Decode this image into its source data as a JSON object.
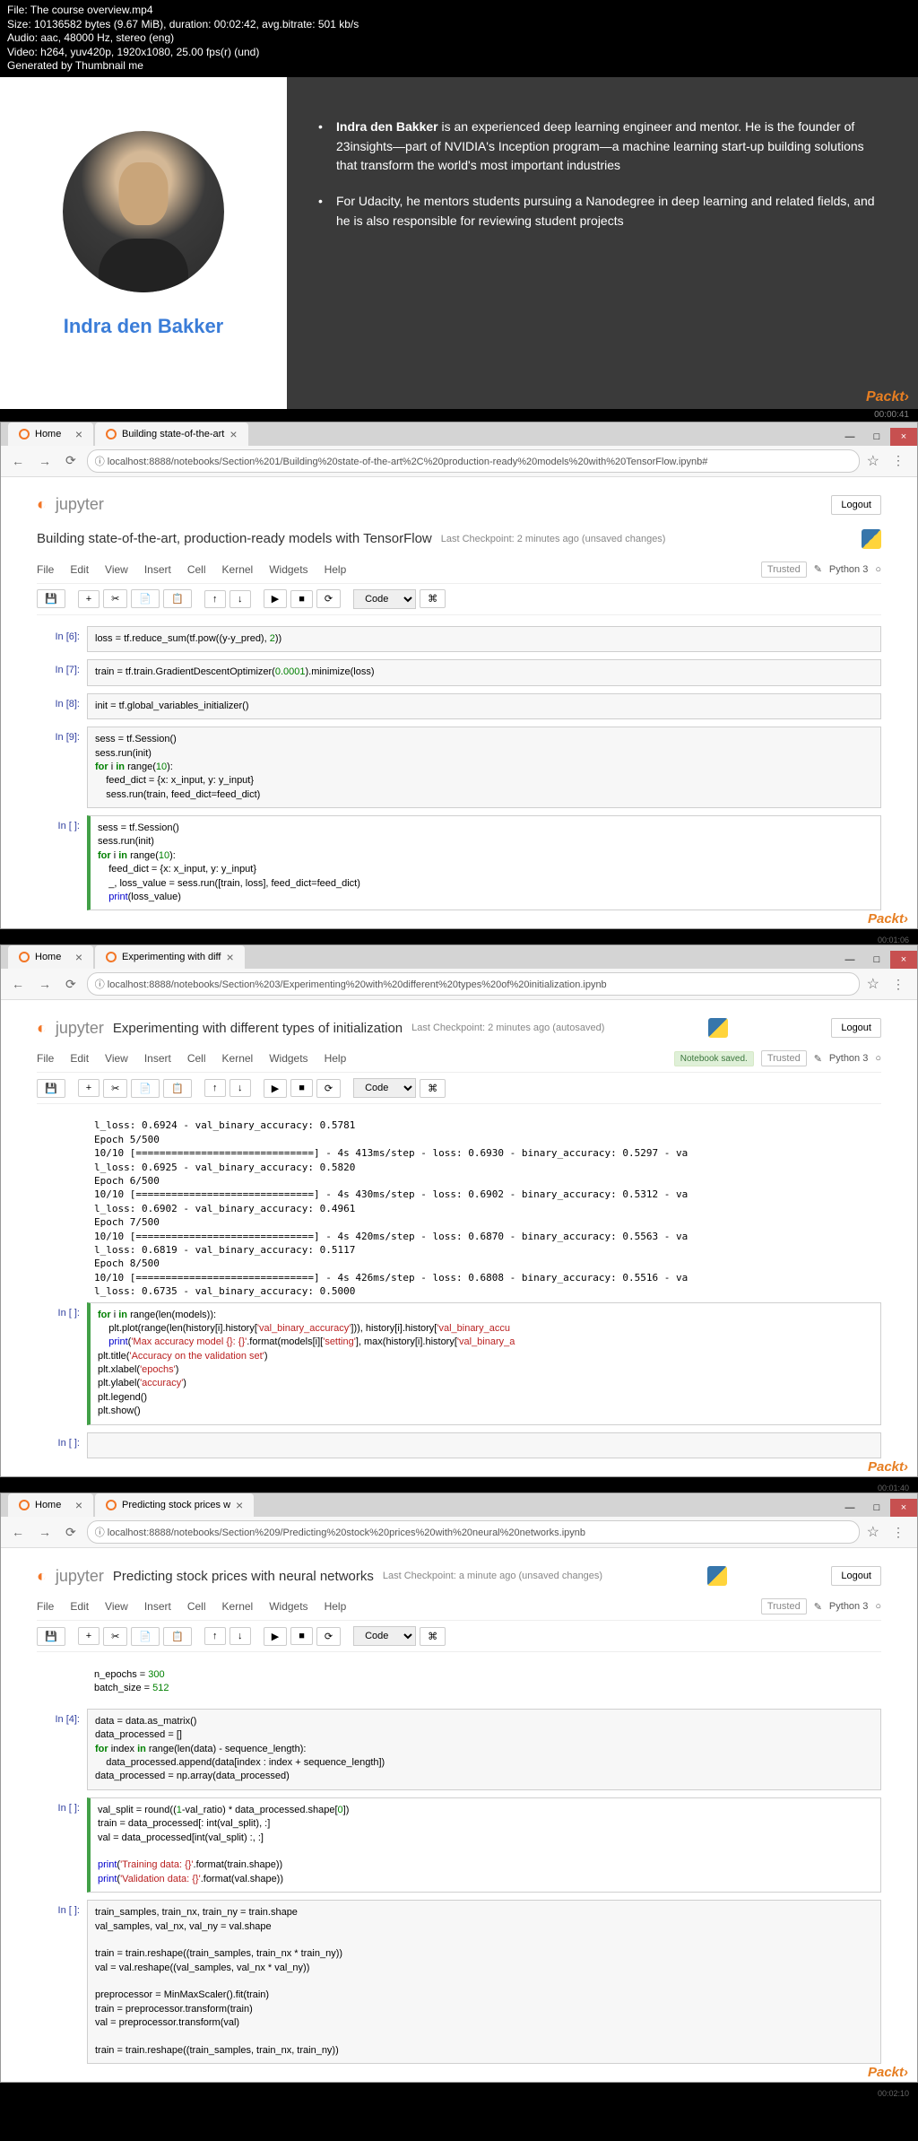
{
  "file_info": {
    "l1": "File: The course overview.mp4",
    "l2": "Size: 10136582 bytes (9.67 MiB), duration: 00:02:42, avg.bitrate: 501 kb/s",
    "l3": "Audio: aac, 48000 Hz, stereo (eng)",
    "l4": "Video: h264, yuv420p, 1920x1080, 25.00 fps(r) (und)",
    "l5": "Generated by Thumbnail me"
  },
  "slide": {
    "author": "Indra den Bakker",
    "bullet1_name": "Indra den Bakker",
    "bullet1_rest": " is an experienced deep learning engineer and mentor. He is the founder of 23insights—part of NVIDIA's Inception program—a machine learning start-up building solutions that transform the world's most important industries",
    "bullet2": "For Udacity, he mentors students pursuing a Nanodegree in deep learning and related fields, and he is also responsible for reviewing student projects",
    "logo": "Packt›",
    "ts": "00:00:41"
  },
  "browsers": [
    {
      "tabs": [
        "Home",
        "Building state-of-the-art"
      ],
      "url": "localhost:8888/notebooks/Section%201/Building%20state-of-the-art%2C%20production-ready%20models%20with%20TensorFlow.ipynb#",
      "title": "Building state-of-the-art, production-ready models with TensorFlow",
      "checkpoint": "Last Checkpoint: 2 minutes ago (unsaved changes)",
      "trusted": "Trusted",
      "kernel": "Python 3",
      "saved": "",
      "ts": "00:01:06"
    },
    {
      "tabs": [
        "Home",
        "Experimenting with diff"
      ],
      "url": "localhost:8888/notebooks/Section%203/Experimenting%20with%20different%20types%20of%20initialization.ipynb",
      "title": "Experimenting with different types of initialization",
      "checkpoint": "Last Checkpoint: 2 minutes ago (autosaved)",
      "trusted": "Trusted",
      "kernel": "Python 3",
      "saved": "Notebook saved.",
      "ts": "00:01:40"
    },
    {
      "tabs": [
        "Home",
        "Predicting stock prices w"
      ],
      "url": "localhost:8888/notebooks/Section%209/Predicting%20stock%20prices%20with%20neural%20networks.ipynb",
      "title": "Predicting stock prices with neural networks",
      "checkpoint": "Last Checkpoint: a minute ago (unsaved changes)",
      "trusted": "Trusted",
      "kernel": "Python 3",
      "saved": "",
      "ts": "00:02:10"
    }
  ],
  "menubar": [
    "File",
    "Edit",
    "View",
    "Insert",
    "Cell",
    "Kernel",
    "Widgets",
    "Help"
  ],
  "toolbar_code": "Code",
  "logout": "Logout",
  "jupyter": "jupyter",
  "packt": "Packt›"
}
